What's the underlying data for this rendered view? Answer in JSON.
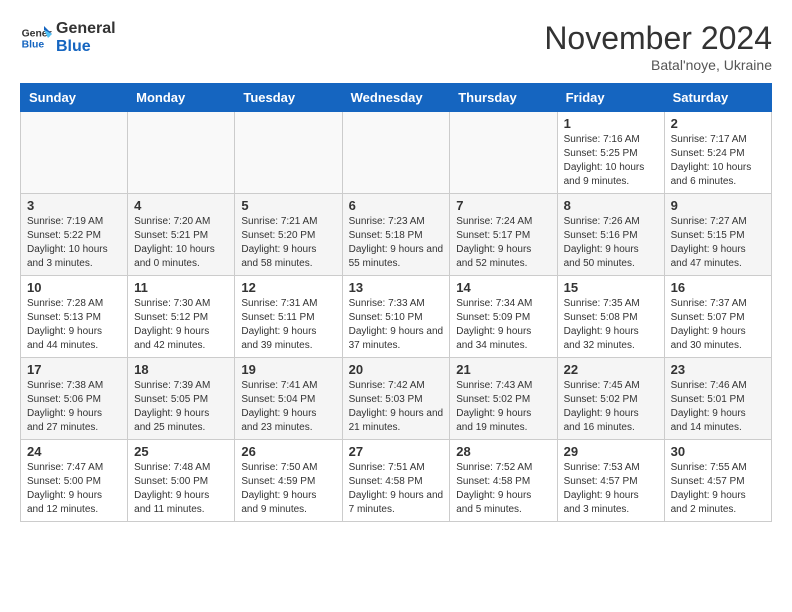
{
  "header": {
    "logo_line1": "General",
    "logo_line2": "Blue",
    "month": "November 2024",
    "location": "Batal'noye, Ukraine"
  },
  "days_of_week": [
    "Sunday",
    "Monday",
    "Tuesday",
    "Wednesday",
    "Thursday",
    "Friday",
    "Saturday"
  ],
  "weeks": [
    [
      {
        "day": "",
        "info": ""
      },
      {
        "day": "",
        "info": ""
      },
      {
        "day": "",
        "info": ""
      },
      {
        "day": "",
        "info": ""
      },
      {
        "day": "",
        "info": ""
      },
      {
        "day": "1",
        "info": "Sunrise: 7:16 AM\nSunset: 5:25 PM\nDaylight: 10 hours and 9 minutes."
      },
      {
        "day": "2",
        "info": "Sunrise: 7:17 AM\nSunset: 5:24 PM\nDaylight: 10 hours and 6 minutes."
      }
    ],
    [
      {
        "day": "3",
        "info": "Sunrise: 7:19 AM\nSunset: 5:22 PM\nDaylight: 10 hours and 3 minutes."
      },
      {
        "day": "4",
        "info": "Sunrise: 7:20 AM\nSunset: 5:21 PM\nDaylight: 10 hours and 0 minutes."
      },
      {
        "day": "5",
        "info": "Sunrise: 7:21 AM\nSunset: 5:20 PM\nDaylight: 9 hours and 58 minutes."
      },
      {
        "day": "6",
        "info": "Sunrise: 7:23 AM\nSunset: 5:18 PM\nDaylight: 9 hours and 55 minutes."
      },
      {
        "day": "7",
        "info": "Sunrise: 7:24 AM\nSunset: 5:17 PM\nDaylight: 9 hours and 52 minutes."
      },
      {
        "day": "8",
        "info": "Sunrise: 7:26 AM\nSunset: 5:16 PM\nDaylight: 9 hours and 50 minutes."
      },
      {
        "day": "9",
        "info": "Sunrise: 7:27 AM\nSunset: 5:15 PM\nDaylight: 9 hours and 47 minutes."
      }
    ],
    [
      {
        "day": "10",
        "info": "Sunrise: 7:28 AM\nSunset: 5:13 PM\nDaylight: 9 hours and 44 minutes."
      },
      {
        "day": "11",
        "info": "Sunrise: 7:30 AM\nSunset: 5:12 PM\nDaylight: 9 hours and 42 minutes."
      },
      {
        "day": "12",
        "info": "Sunrise: 7:31 AM\nSunset: 5:11 PM\nDaylight: 9 hours and 39 minutes."
      },
      {
        "day": "13",
        "info": "Sunrise: 7:33 AM\nSunset: 5:10 PM\nDaylight: 9 hours and 37 minutes."
      },
      {
        "day": "14",
        "info": "Sunrise: 7:34 AM\nSunset: 5:09 PM\nDaylight: 9 hours and 34 minutes."
      },
      {
        "day": "15",
        "info": "Sunrise: 7:35 AM\nSunset: 5:08 PM\nDaylight: 9 hours and 32 minutes."
      },
      {
        "day": "16",
        "info": "Sunrise: 7:37 AM\nSunset: 5:07 PM\nDaylight: 9 hours and 30 minutes."
      }
    ],
    [
      {
        "day": "17",
        "info": "Sunrise: 7:38 AM\nSunset: 5:06 PM\nDaylight: 9 hours and 27 minutes."
      },
      {
        "day": "18",
        "info": "Sunrise: 7:39 AM\nSunset: 5:05 PM\nDaylight: 9 hours and 25 minutes."
      },
      {
        "day": "19",
        "info": "Sunrise: 7:41 AM\nSunset: 5:04 PM\nDaylight: 9 hours and 23 minutes."
      },
      {
        "day": "20",
        "info": "Sunrise: 7:42 AM\nSunset: 5:03 PM\nDaylight: 9 hours and 21 minutes."
      },
      {
        "day": "21",
        "info": "Sunrise: 7:43 AM\nSunset: 5:02 PM\nDaylight: 9 hours and 19 minutes."
      },
      {
        "day": "22",
        "info": "Sunrise: 7:45 AM\nSunset: 5:02 PM\nDaylight: 9 hours and 16 minutes."
      },
      {
        "day": "23",
        "info": "Sunrise: 7:46 AM\nSunset: 5:01 PM\nDaylight: 9 hours and 14 minutes."
      }
    ],
    [
      {
        "day": "24",
        "info": "Sunrise: 7:47 AM\nSunset: 5:00 PM\nDaylight: 9 hours and 12 minutes."
      },
      {
        "day": "25",
        "info": "Sunrise: 7:48 AM\nSunset: 5:00 PM\nDaylight: 9 hours and 11 minutes."
      },
      {
        "day": "26",
        "info": "Sunrise: 7:50 AM\nSunset: 4:59 PM\nDaylight: 9 hours and 9 minutes."
      },
      {
        "day": "27",
        "info": "Sunrise: 7:51 AM\nSunset: 4:58 PM\nDaylight: 9 hours and 7 minutes."
      },
      {
        "day": "28",
        "info": "Sunrise: 7:52 AM\nSunset: 4:58 PM\nDaylight: 9 hours and 5 minutes."
      },
      {
        "day": "29",
        "info": "Sunrise: 7:53 AM\nSunset: 4:57 PM\nDaylight: 9 hours and 3 minutes."
      },
      {
        "day": "30",
        "info": "Sunrise: 7:55 AM\nSunset: 4:57 PM\nDaylight: 9 hours and 2 minutes."
      }
    ]
  ]
}
